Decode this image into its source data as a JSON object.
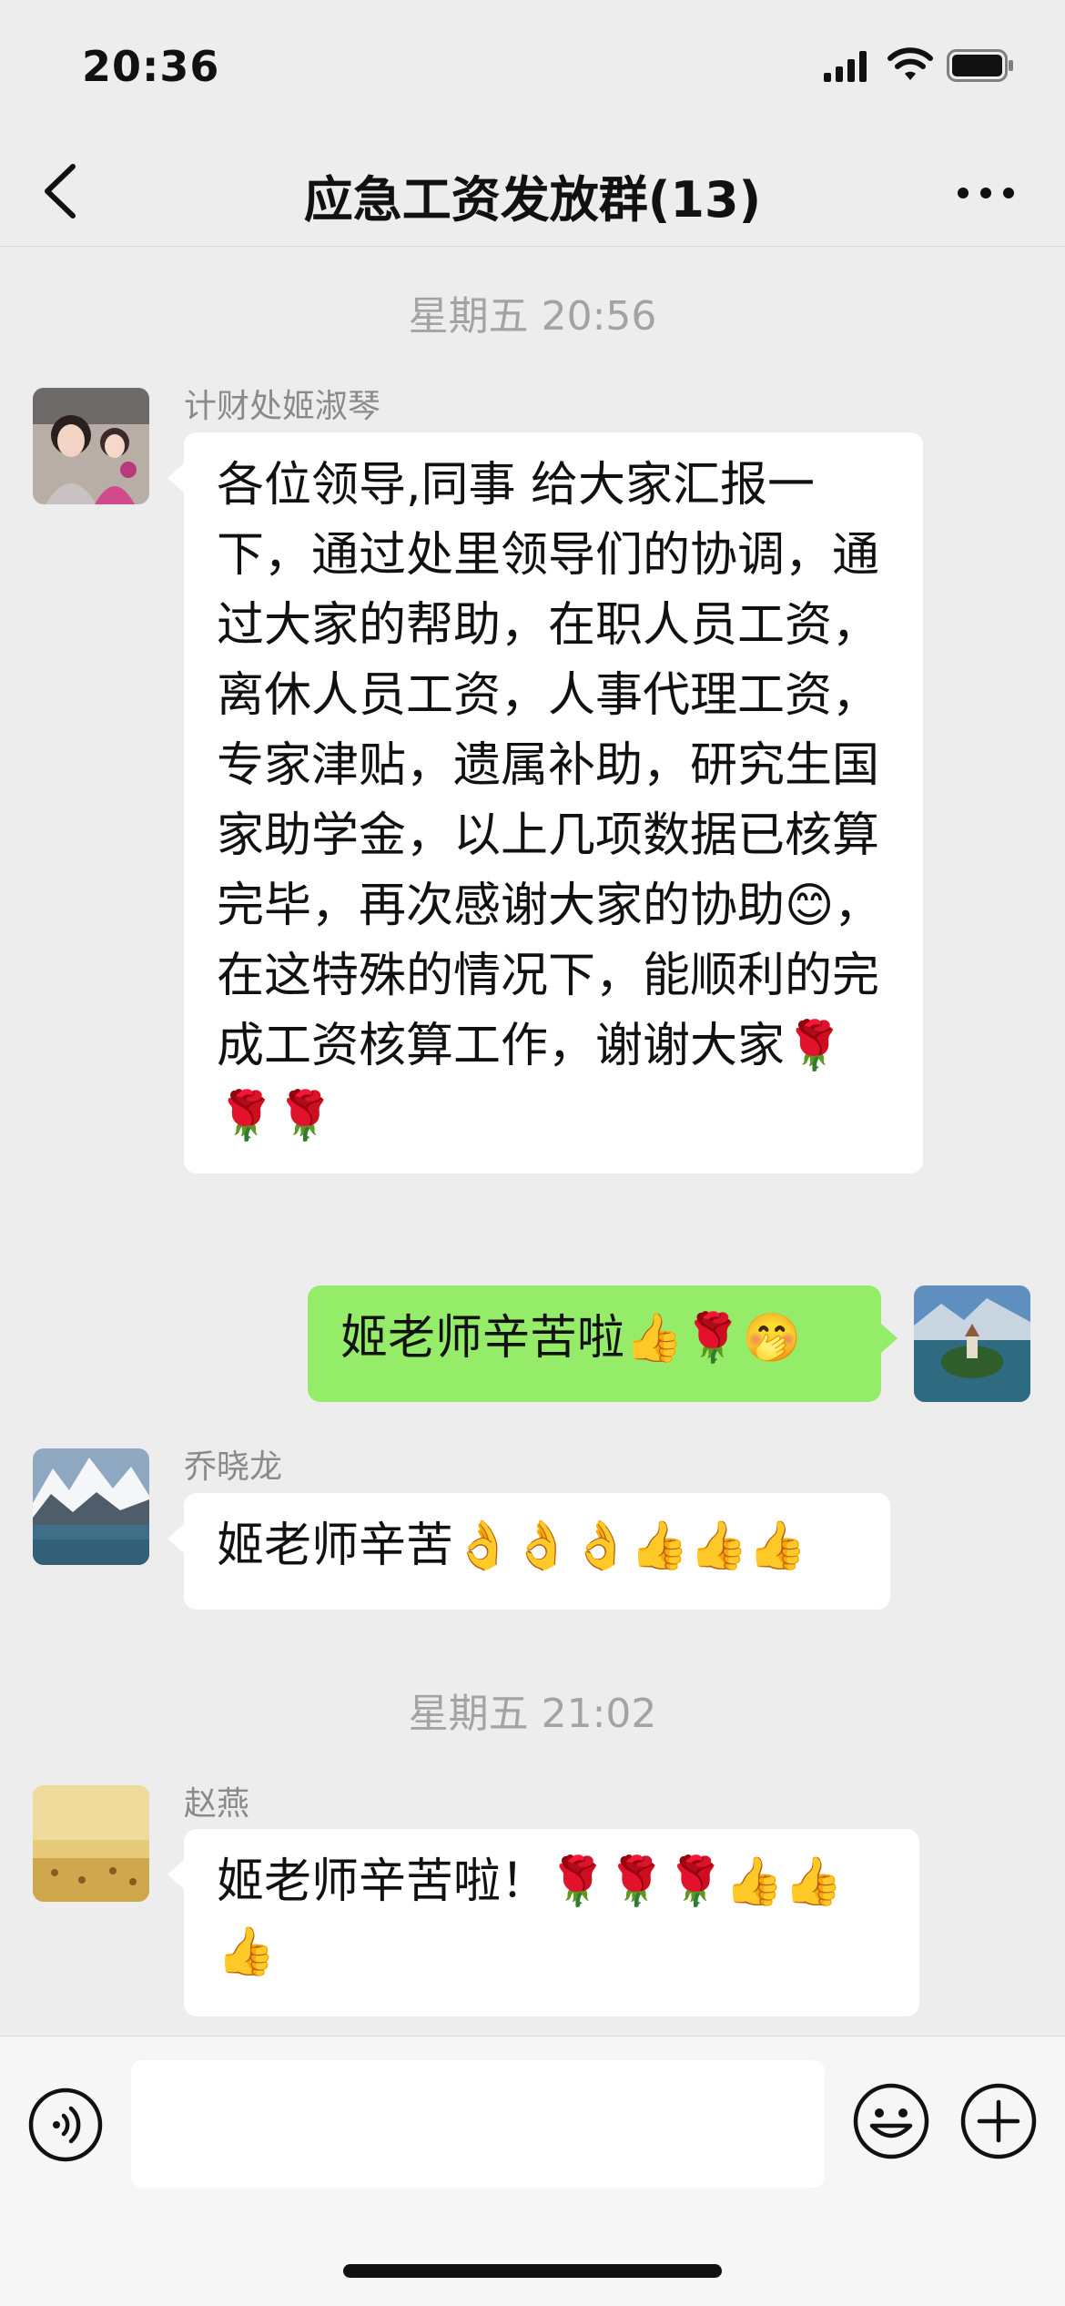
{
  "status_bar": {
    "time": "20:36"
  },
  "header": {
    "title": "应急工资发放群(13)"
  },
  "messages": {
    "timestamp1": "星期五 20:56",
    "m1": {
      "sender": "计财处姬淑琴",
      "text": "各位领导,同事 给大家汇报一下，通过处里领导们的协调，通过大家的帮助，在职人员工资，离休人员工资，人事代理工资，专家津贴，遗属补助，研究生国家助学金，以上几项数据已核算完毕，再次感谢大家的协助😊，在这特殊的情况下，能顺利的完成工资核算工作，谢谢大家🌹🌹🌹"
    },
    "m2": {
      "text": "姬老师辛苦啦👍🌹🤭"
    },
    "m3": {
      "sender": "乔晓龙",
      "text": "姬老师辛苦👌👌👌👍👍👍"
    },
    "timestamp2": "星期五 21:02",
    "m4": {
      "sender": "赵燕",
      "text": "姬老师辛苦啦！🌹🌹🌹👍👍👍"
    }
  },
  "input_bar": {
    "placeholder": ""
  },
  "colors": {
    "background": "#ededed",
    "bubble_self": "#95ec69",
    "bubble_other": "#ffffff"
  },
  "icons": [
    "back-arrow-icon",
    "more-dots-icon",
    "voice-icon",
    "emoji-icon",
    "plus-icon",
    "signal-icon",
    "wifi-icon",
    "battery-icon"
  ]
}
